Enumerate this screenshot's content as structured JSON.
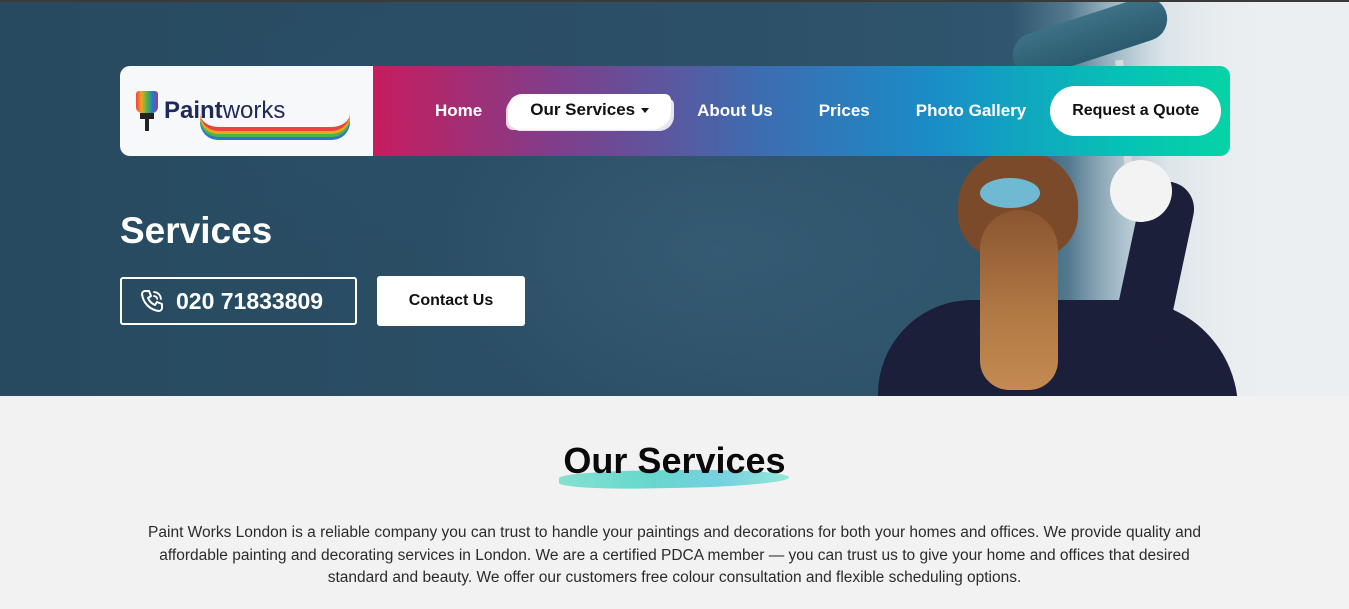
{
  "brand": {
    "logo_text_bold": "Paint",
    "logo_text_light": "works"
  },
  "nav": {
    "items": [
      {
        "label": "Home"
      },
      {
        "label": "Our Services"
      },
      {
        "label": "About Us"
      },
      {
        "label": "Prices"
      },
      {
        "label": "Photo Gallery"
      }
    ],
    "cta_label": "Request a Quote"
  },
  "hero": {
    "title": "Services",
    "phone": "020 71833809",
    "contact_label": "Contact Us"
  },
  "services": {
    "heading": "Our Services",
    "description": "Paint Works London is a reliable company you can trust to handle your paintings and decorations for both your homes and offices. We provide quality and affordable painting and decorating services in London. We are a certified PDCA member — you can trust us to give your home and offices that desired standard and beauty. We offer our customers free colour consultation and flexible scheduling options."
  },
  "colors": {
    "hero_bg": "#2a4d63",
    "nav_gradient_start": "#c71d5e",
    "nav_gradient_end": "#06d3a6",
    "heading_stroke": "#5fd6cb"
  },
  "icons": [
    "phone-icon",
    "caret-down-icon",
    "paintbrush-logo-icon"
  ]
}
